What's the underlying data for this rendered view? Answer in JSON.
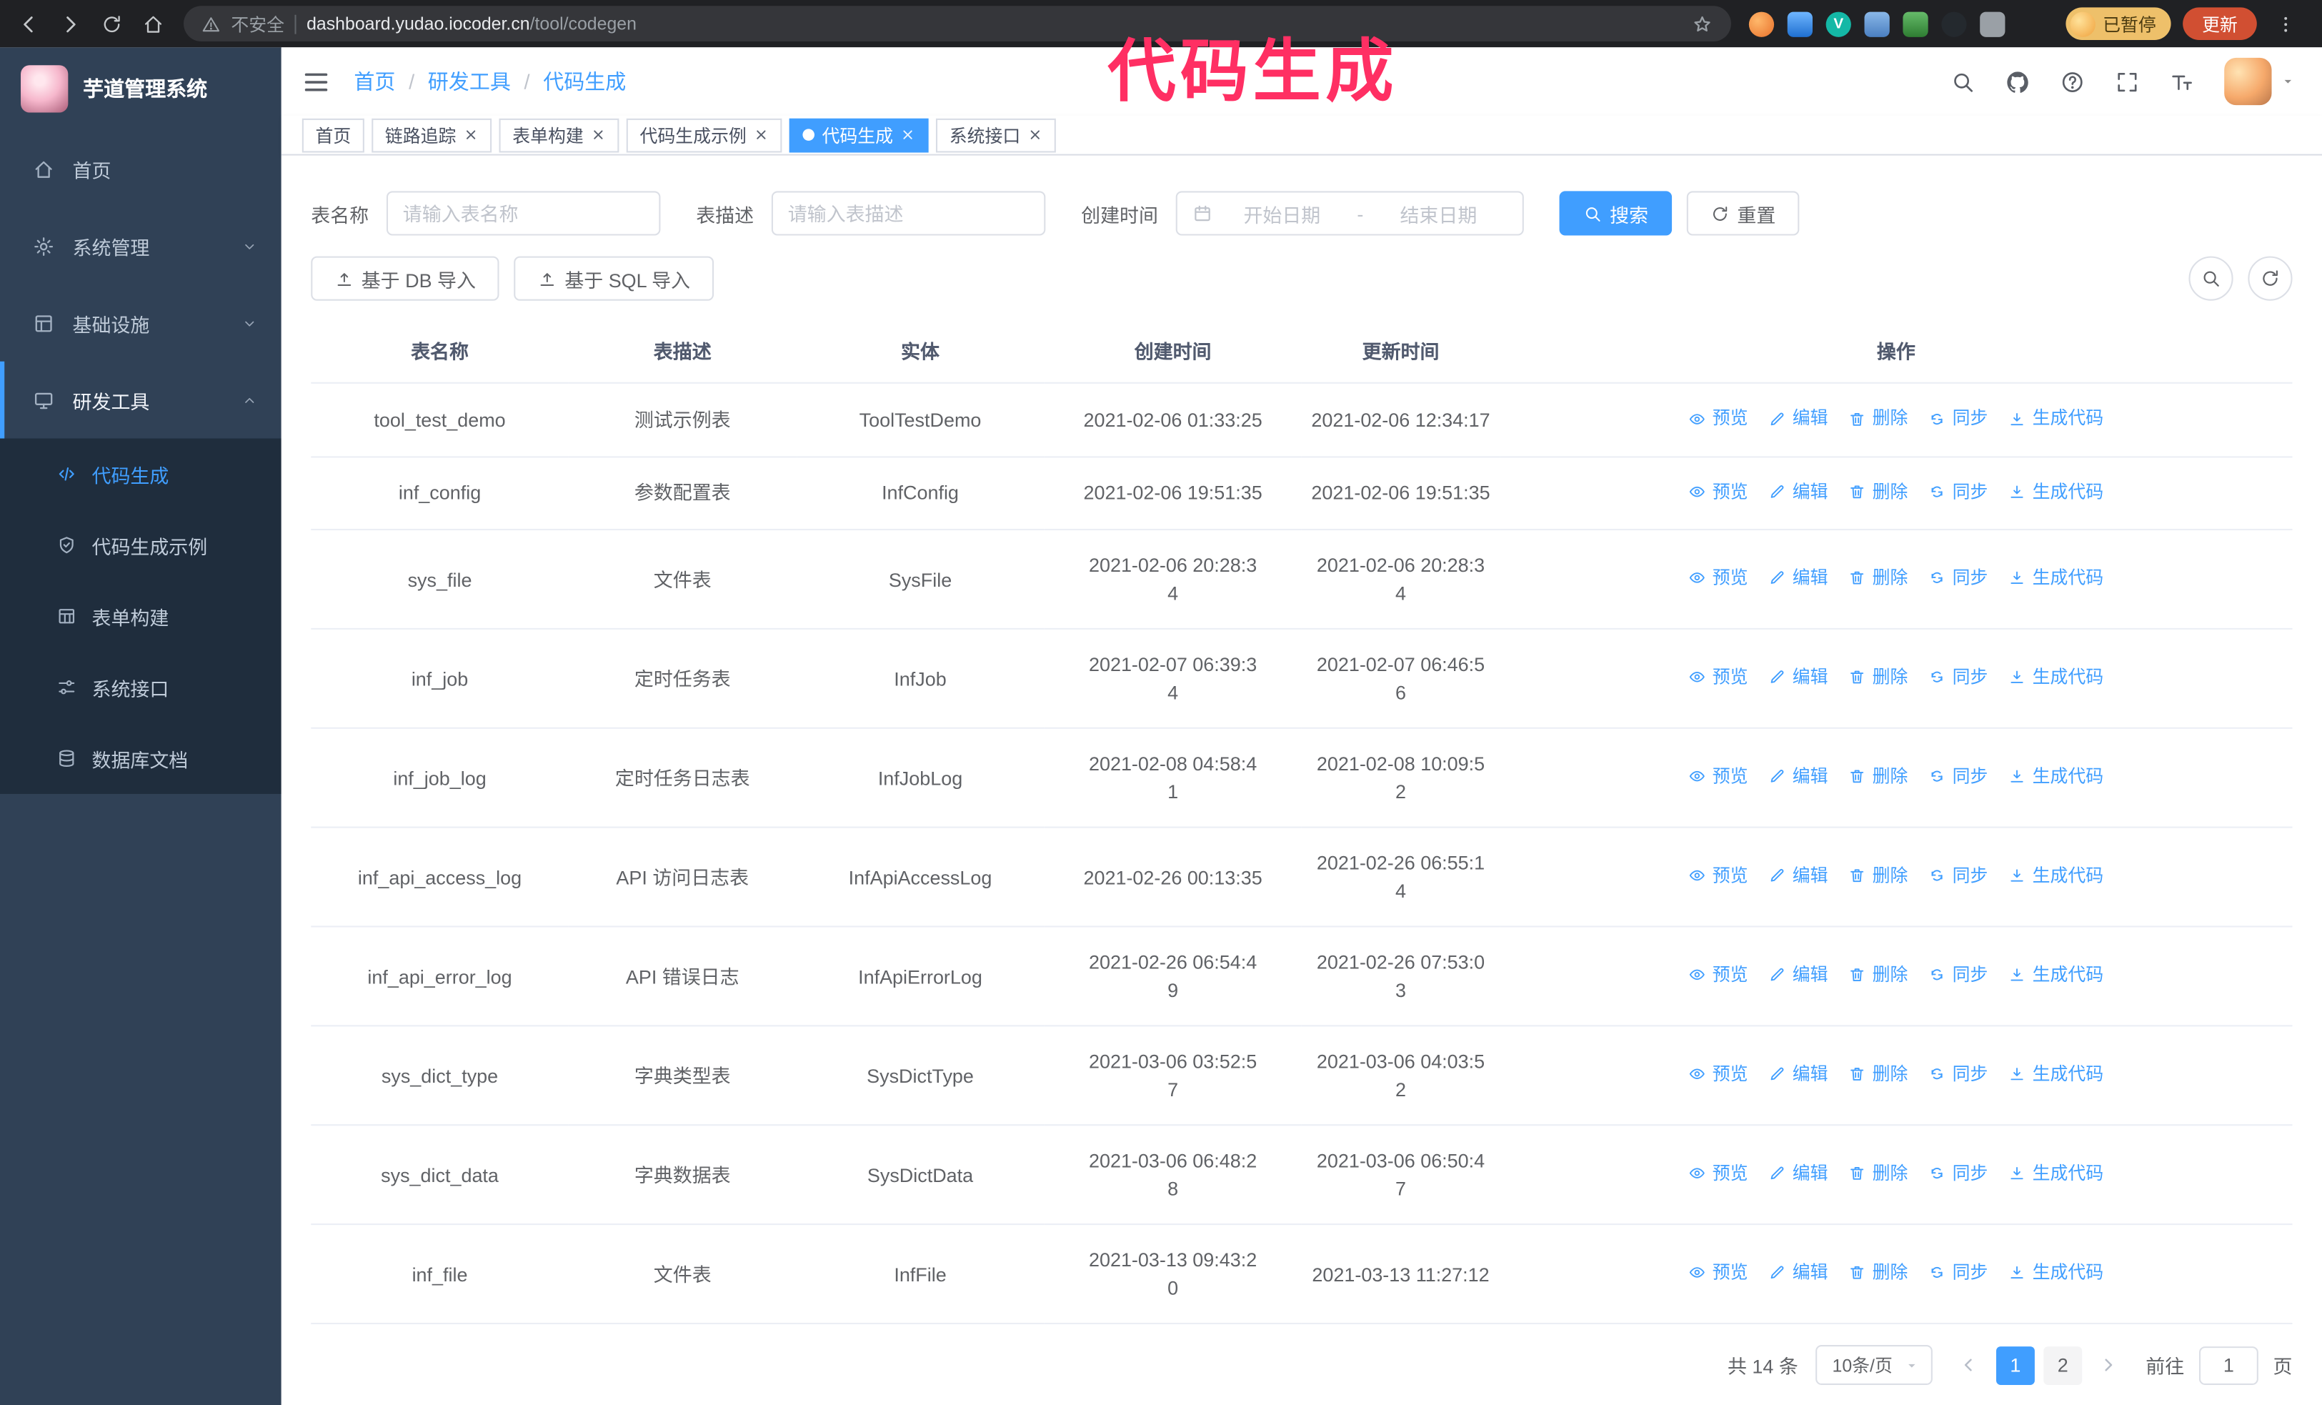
{
  "browser": {
    "security_label": "不安全",
    "url_domain": "dashboard.yudao.iocoder.cn",
    "url_path": "/tool/codegen",
    "paused_badge": "已暂停",
    "update_button": "更新"
  },
  "annotation": {
    "text": "代码生成",
    "color": "#ff2f63"
  },
  "sidebar": {
    "logo_title": "芋道管理系统",
    "menu": [
      {
        "label": "首页",
        "icon": "home-icon"
      },
      {
        "label": "系统管理",
        "icon": "gear-icon",
        "chevron": "down"
      },
      {
        "label": "基础设施",
        "icon": "infrastructure-icon",
        "chevron": "down"
      },
      {
        "label": "研发工具",
        "icon": "dev-tools-icon",
        "chevron": "up",
        "expanded": true,
        "children": [
          {
            "label": "代码生成",
            "icon": "code-icon",
            "active": true
          },
          {
            "label": "代码生成示例",
            "icon": "shield-check-icon"
          },
          {
            "label": "表单构建",
            "icon": "form-icon"
          },
          {
            "label": "系统接口",
            "icon": "sliders-icon"
          },
          {
            "label": "数据库文档",
            "icon": "database-icon"
          }
        ]
      }
    ]
  },
  "header": {
    "breadcrumb": [
      "首页",
      "研发工具",
      "代码生成"
    ],
    "breadcrumb_separator": "/"
  },
  "tabs": [
    {
      "label": "首页",
      "active": false,
      "closable": false
    },
    {
      "label": "链路追踪",
      "active": false,
      "closable": true
    },
    {
      "label": "表单构建",
      "active": false,
      "closable": true
    },
    {
      "label": "代码生成示例",
      "active": false,
      "closable": true
    },
    {
      "label": "代码生成",
      "active": true,
      "closable": true
    },
    {
      "label": "系统接口",
      "active": false,
      "closable": true
    }
  ],
  "search_form": {
    "table_name": {
      "label": "表名称",
      "placeholder": "请输入表名称",
      "value": ""
    },
    "table_desc": {
      "label": "表描述",
      "placeholder": "请输入表描述",
      "value": ""
    },
    "create_time": {
      "label": "创建时间",
      "start_placeholder": "开始日期",
      "separator": "-",
      "end_placeholder": "结束日期"
    },
    "search_button": "搜索",
    "reset_button": "重置"
  },
  "toolbar": {
    "import_db_button": "基于 DB 导入",
    "import_sql_button": "基于 SQL 导入"
  },
  "table": {
    "headers": [
      "表名称",
      "表描述",
      "实体",
      "创建时间",
      "更新时间",
      "操作"
    ],
    "actions": [
      {
        "label": "预览",
        "icon": "eye-icon"
      },
      {
        "label": "编辑",
        "icon": "edit-icon"
      },
      {
        "label": "删除",
        "icon": "delete-icon"
      },
      {
        "label": "同步",
        "icon": "sync-icon"
      },
      {
        "label": "生成代码",
        "icon": "download-icon"
      }
    ],
    "rows": [
      {
        "table_name": "tool_test_demo",
        "table_desc": "测试示例表",
        "entity": "ToolTestDemo",
        "create_time": "2021-02-06 01:33:25",
        "update_time": "2021-02-06 12:34:17",
        "create_wrap": false,
        "update_wrap": false
      },
      {
        "table_name": "inf_config",
        "table_desc": "参数配置表",
        "entity": "InfConfig",
        "create_time": "2021-02-06 19:51:35",
        "update_time": "2021-02-06 19:51:35",
        "create_wrap": false,
        "update_wrap": false
      },
      {
        "table_name": "sys_file",
        "table_desc": "文件表",
        "entity": "SysFile",
        "create_time": "2021-02-06 20:28:34",
        "update_time": "2021-02-06 20:28:34",
        "create_wrap": true,
        "update_wrap": true
      },
      {
        "table_name": "inf_job",
        "table_desc": "定时任务表",
        "entity": "InfJob",
        "create_time": "2021-02-07 06:39:34",
        "update_time": "2021-02-07 06:46:56",
        "create_wrap": true,
        "update_wrap": true
      },
      {
        "table_name": "inf_job_log",
        "table_desc": "定时任务日志表",
        "entity": "InfJobLog",
        "create_time": "2021-02-08 04:58:41",
        "update_time": "2021-02-08 10:09:52",
        "create_wrap": true,
        "update_wrap": true
      },
      {
        "table_name": "inf_api_access_log",
        "table_desc": "API 访问日志表",
        "entity": "InfApiAccessLog",
        "create_time": "2021-02-26 00:13:35",
        "update_time": "2021-02-26 06:55:14",
        "create_wrap": false,
        "update_wrap": true
      },
      {
        "table_name": "inf_api_error_log",
        "table_desc": "API 错误日志",
        "entity": "InfApiErrorLog",
        "create_time": "2021-02-26 06:54:49",
        "update_time": "2021-02-26 07:53:03",
        "create_wrap": true,
        "update_wrap": true
      },
      {
        "table_name": "sys_dict_type",
        "table_desc": "字典类型表",
        "entity": "SysDictType",
        "create_time": "2021-03-06 03:52:57",
        "update_time": "2021-03-06 04:03:52",
        "create_wrap": true,
        "update_wrap": true
      },
      {
        "table_name": "sys_dict_data",
        "table_desc": "字典数据表",
        "entity": "SysDictData",
        "create_time": "2021-03-06 06:48:28",
        "update_time": "2021-03-06 06:50:47",
        "create_wrap": true,
        "update_wrap": true
      },
      {
        "table_name": "inf_file",
        "table_desc": "文件表",
        "entity": "InfFile",
        "create_time": "2021-03-13 09:43:20",
        "update_time": "2021-03-13 11:27:12",
        "create_wrap": true,
        "update_wrap": false
      }
    ]
  },
  "pagination": {
    "total_text": "共 14 条",
    "page_size": "10条/页",
    "pages": [
      "1",
      "2"
    ],
    "active_page": "1",
    "goto_label": "前往",
    "goto_value": "1",
    "goto_suffix": "页"
  },
  "colors": {
    "accent": "#409eff",
    "sidebar_bg": "#304156",
    "submenu_bg": "#1f2d3d",
    "annotation": "#ff2f63"
  }
}
